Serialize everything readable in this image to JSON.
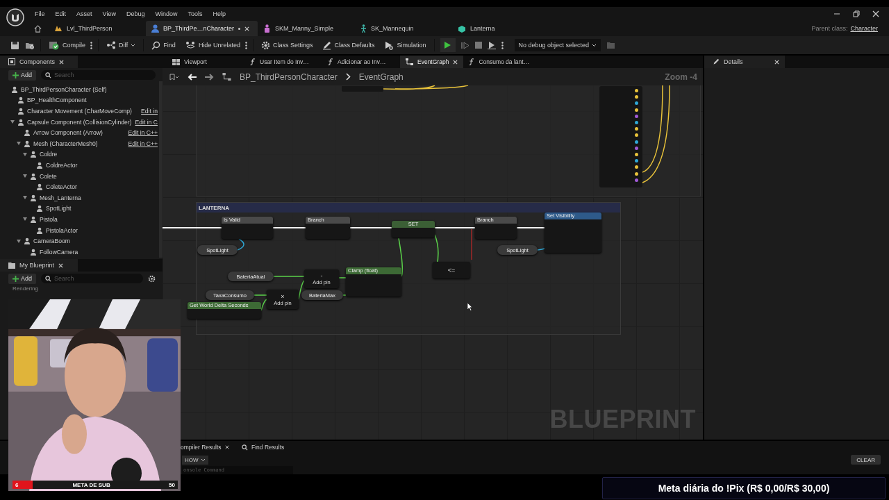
{
  "menu": [
    "File",
    "Edit",
    "Asset",
    "View",
    "Debug",
    "Window",
    "Tools",
    "Help"
  ],
  "doc_tabs": [
    {
      "label": "Lvl_ThirdPerson",
      "kind": "level",
      "selected": false,
      "modified": false
    },
    {
      "label": "BP_ThirdPe…nCharacter",
      "kind": "blueprint",
      "selected": true,
      "modified": true
    },
    {
      "label": "SKM_Manny_Simple",
      "kind": "mesh",
      "selected": false,
      "modified": false
    },
    {
      "label": "SK_Mannequin",
      "kind": "skeleton",
      "selected": false,
      "modified": false
    },
    {
      "label": "Lanterna",
      "kind": "static",
      "selected": false,
      "modified": false
    }
  ],
  "parent_class": {
    "label": "Parent class:",
    "value": "Character"
  },
  "toolbar": [
    {
      "label": "Compile",
      "kind": "compile",
      "menu": true
    },
    {
      "label": "Diff",
      "kind": "diff",
      "dropdown": true
    },
    {
      "label": "Find",
      "kind": "find"
    },
    {
      "label": "Hide Unrelated",
      "kind": "hide",
      "menu": true
    },
    {
      "label": "Class Settings",
      "kind": "settings"
    },
    {
      "label": "Class Defaults",
      "kind": "defaults"
    },
    {
      "label": "Simulation",
      "kind": "simulation"
    }
  ],
  "debug_object": "No debug object selected",
  "components": {
    "title": "Components",
    "add": "Add",
    "search": {
      "placeholder": "Search"
    },
    "tree": [
      {
        "label": "BP_ThirdPersonCharacter (Self)",
        "children": [
          {
            "label": "BP_HealthComponent"
          },
          {
            "label": "Character Movement (CharMoveComp)",
            "link": "Edit in"
          },
          {
            "label": "Capsule Component (CollisionCylinder)",
            "link": "Edit in C",
            "expanded": true,
            "children": [
              {
                "label": "Arrow Component (Arrow)",
                "link": "Edit in C++"
              },
              {
                "label": "Mesh (CharacterMesh0)",
                "link": "Edit in C++",
                "expanded": true,
                "children": [
                  {
                    "label": "Coldre",
                    "expanded": true,
                    "children": [
                      {
                        "label": "ColdreActor"
                      }
                    ]
                  },
                  {
                    "label": "Colete",
                    "expanded": true,
                    "children": [
                      {
                        "label": "ColeteActor"
                      }
                    ]
                  },
                  {
                    "label": "Mesh_Lanterna",
                    "expanded": true,
                    "children": [
                      {
                        "label": "SpotLight"
                      }
                    ]
                  },
                  {
                    "label": "Pistola",
                    "expanded": true,
                    "children": [
                      {
                        "label": "PistolaActor"
                      }
                    ]
                  }
                ]
              },
              {
                "label": "CameraBoom",
                "expanded": true,
                "children": [
                  {
                    "label": "FollowCamera"
                  }
                ]
              }
            ]
          }
        ]
      }
    ]
  },
  "my_blueprint": {
    "title": "My Blueprint",
    "add": "Add",
    "search": {
      "placeholder": "Search"
    },
    "category": "Rendering"
  },
  "graph_tabs": [
    {
      "label": "Viewport",
      "kind": "viewport",
      "selected": false
    },
    {
      "label": "Usar Item do Inv…",
      "kind": "function",
      "selected": false
    },
    {
      "label": "Adicionar ao Inv…",
      "kind": "function",
      "selected": false
    },
    {
      "label": "EventGraph",
      "kind": "graph",
      "selected": true
    },
    {
      "label": "Consumo da lant…",
      "kind": "function",
      "selected": false
    }
  ],
  "graph": {
    "breadcrumb": [
      "BP_ThirdPersonCharacter",
      "EventGraph"
    ],
    "zoom": "Zoom -4",
    "comment": "LANTERNA",
    "watermark": "BLUEPRINT",
    "nodes": [
      {
        "kind": "exec",
        "title": "Is Valid"
      },
      {
        "kind": "exec",
        "title": "Branch"
      },
      {
        "kind": "set",
        "title": "SET"
      },
      {
        "kind": "exec",
        "title": "Branch"
      },
      {
        "kind": "function",
        "title": "Set Visibility"
      },
      {
        "kind": "variable",
        "title": "SpotLight"
      },
      {
        "kind": "variable",
        "title": "SpotLight"
      },
      {
        "kind": "variable",
        "title": "BateriaAtual"
      },
      {
        "kind": "variable",
        "title": "TaxaConsumo"
      },
      {
        "kind": "variable",
        "title": "BateriaMax"
      },
      {
        "kind": "pure",
        "title": "Get World Delta Seconds"
      },
      {
        "kind": "operator",
        "title": "×",
        "pin": "Add pin"
      },
      {
        "kind": "operator",
        "title": "-",
        "pin": "Add pin"
      },
      {
        "kind": "pure",
        "title": "Clamp (float)"
      },
      {
        "kind": "operator",
        "title": "<="
      }
    ]
  },
  "details": {
    "title": "Details"
  },
  "bottom": {
    "tabs": [
      "ompiler Results",
      "Find Results"
    ],
    "show": "HOW",
    "console": {
      "placeholder": "onsole Command"
    },
    "clear": "CLEAR"
  },
  "overlay": {
    "sub_goal": {
      "current": "6",
      "label": "META DE SUB",
      "target": "50",
      "level": 0.12
    },
    "pix": "Meta diária do !Pix (R$ 0,00/R$ 30,00)"
  }
}
